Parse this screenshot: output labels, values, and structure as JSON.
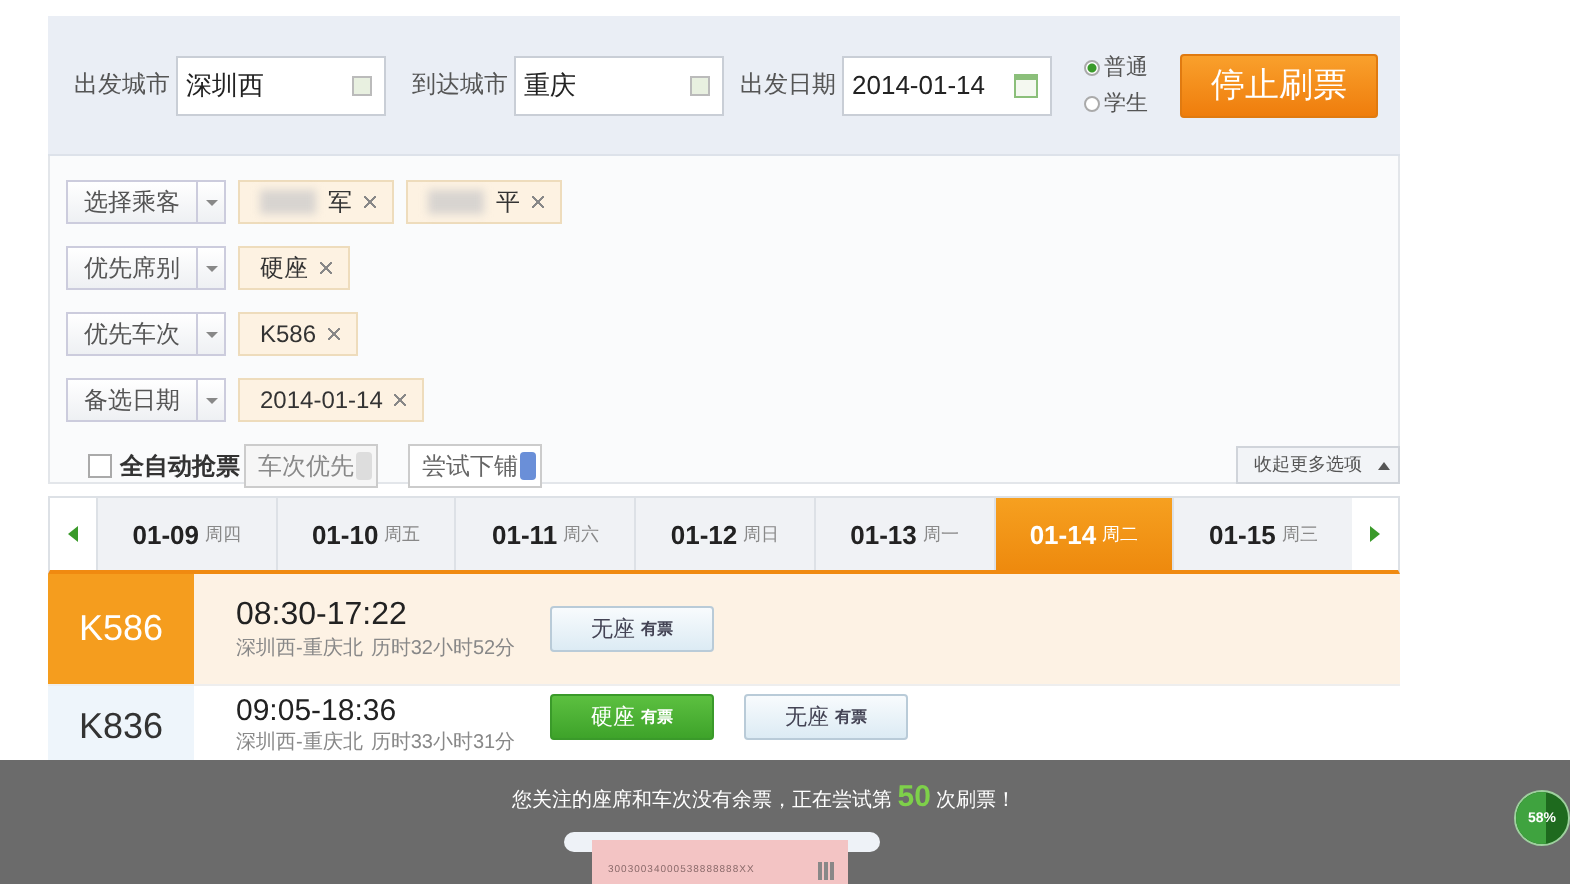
{
  "search": {
    "from_label": "出发城市",
    "from": "深圳西",
    "to_label": "到达城市",
    "to": "重庆",
    "date_label": "出发日期",
    "date": "2014-01-14",
    "ticket_types": [
      {
        "label": "普通",
        "selected": true
      },
      {
        "label": "学生",
        "selected": false
      }
    ],
    "submit": "停止刷票"
  },
  "options": {
    "filters": [
      {
        "label": "选择乘客",
        "chips": [
          {
            "text": "军",
            "blurred": true
          },
          {
            "text": "平",
            "blurred": true
          }
        ]
      },
      {
        "label": "优先席别",
        "chips": [
          {
            "text": "硬座",
            "blurred": false
          }
        ]
      },
      {
        "label": "优先车次",
        "chips": [
          {
            "text": "K586",
            "blurred": false
          }
        ]
      },
      {
        "label": "备选日期",
        "chips": [
          {
            "text": "2014-01-14",
            "blurred": false
          }
        ]
      }
    ],
    "auto_grab": {
      "label": "全自动抢票",
      "checked": false
    },
    "selects": [
      {
        "value": "车次优先",
        "disabled": true
      },
      {
        "value": "尝试下铺",
        "disabled": false
      }
    ],
    "collapse": "收起更多选项"
  },
  "date_tabs": [
    {
      "date": "01-09",
      "weekday": "周四",
      "selected": false
    },
    {
      "date": "01-10",
      "weekday": "周五",
      "selected": false
    },
    {
      "date": "01-11",
      "weekday": "周六",
      "selected": false
    },
    {
      "date": "01-12",
      "weekday": "周日",
      "selected": false
    },
    {
      "date": "01-13",
      "weekday": "周一",
      "selected": false
    },
    {
      "date": "01-14",
      "weekday": "周二",
      "selected": true
    },
    {
      "date": "01-15",
      "weekday": "周三",
      "selected": false
    }
  ],
  "trains": [
    {
      "number": "K586",
      "selected": true,
      "times": "08:30-17:22",
      "route": "深圳西-重庆北",
      "duration": "历时32小时52分",
      "seats": [
        {
          "name": "无座",
          "status": "有票",
          "highlighted": false
        }
      ]
    },
    {
      "number": "K836",
      "selected": false,
      "times": "09:05-18:36",
      "route": "深圳西-重庆北",
      "duration": "历时33小时31分",
      "seats": [
        {
          "name": "硬座",
          "status": "有票",
          "highlighted": true
        },
        {
          "name": "无座",
          "status": "有票",
          "highlighted": false
        }
      ]
    }
  ],
  "notice": {
    "text": "您关注的座席和车次没有余票，正在尝试第 **50** 次刷票！",
    "ticket_number": "30030034000538888888XX",
    "progress": {
      "label": "58%",
      "level": 0.58
    }
  }
}
